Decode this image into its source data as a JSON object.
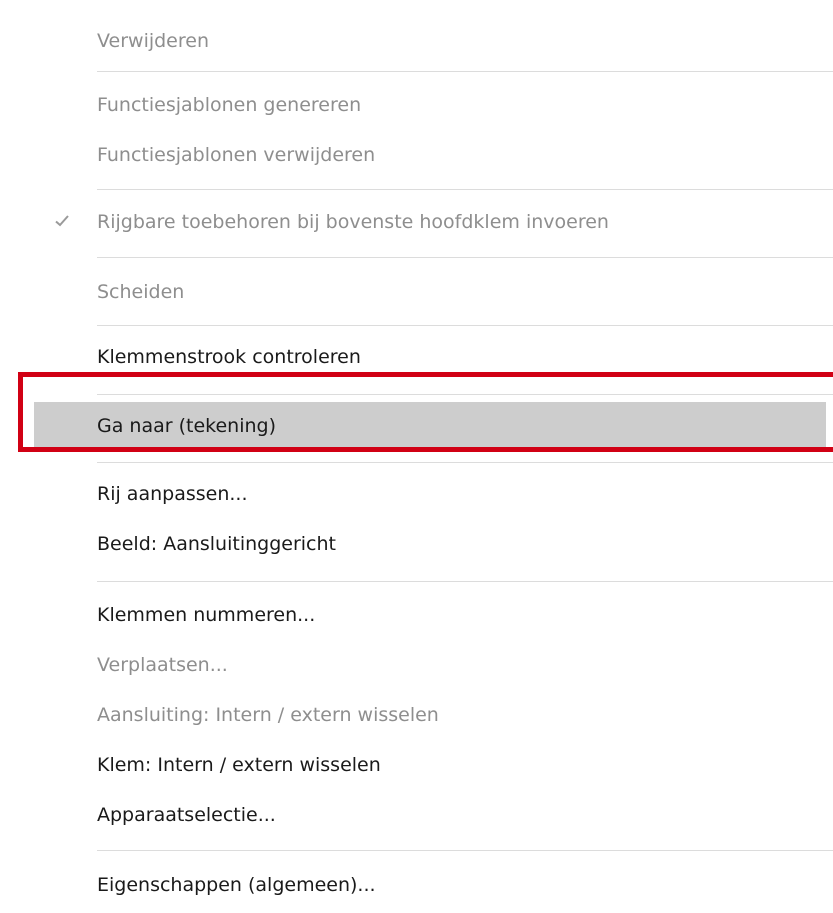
{
  "menu": {
    "items": [
      {
        "label": "Verwijderen",
        "enabled": false
      },
      {
        "label": "Functiesjablonen genereren",
        "enabled": false
      },
      {
        "label": "Functiesjablonen verwijderen",
        "enabled": false
      },
      {
        "label": "Rijgbare toebehoren bij bovenste hoofdklem invoeren",
        "enabled": false,
        "checked": true
      },
      {
        "label": "Scheiden",
        "enabled": false
      },
      {
        "label": "Klemmenstrook controleren",
        "enabled": true
      },
      {
        "label": "Ga naar (tekening)",
        "enabled": true,
        "highlighted": true
      },
      {
        "label": "Rij aanpassen...",
        "enabled": true
      },
      {
        "label": "Beeld: Aansluitinggericht",
        "enabled": true
      },
      {
        "label": "Klemmen nummeren...",
        "enabled": true
      },
      {
        "label": "Verplaatsen...",
        "enabled": false
      },
      {
        "label": "Aansluiting: Intern / extern wisselen",
        "enabled": false
      },
      {
        "label": "Klem: Intern / extern wisselen",
        "enabled": true
      },
      {
        "label": "Apparaatselectie...",
        "enabled": true
      },
      {
        "label": "Eigenschappen (algemeen)...",
        "enabled": true
      }
    ],
    "check_icon": "checkmark-icon",
    "highlight_border_color": "#d10014",
    "hover_color": "#cdcdcd"
  }
}
